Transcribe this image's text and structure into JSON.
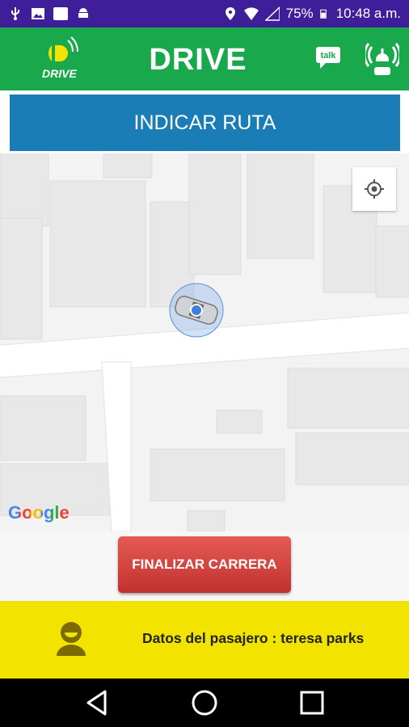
{
  "status_bar": {
    "battery": "75%",
    "time": "10:48 a.m.",
    "icons": [
      "usb-icon",
      "image-icon",
      "white-square-icon",
      "android-icon",
      "location-icon",
      "wifi-icon",
      "signal-icon",
      "battery-icon"
    ]
  },
  "app_bar": {
    "logo_text": "DRIVE",
    "title": "DRIVE",
    "talk_label": "talk",
    "colors": {
      "background": "#19a94c",
      "text": "#ffffff"
    }
  },
  "route_button": {
    "label": "INDICAR RUTA",
    "color": "#1b7db5"
  },
  "map": {
    "attribution": "Google"
  },
  "finish_button": {
    "label": "FINALIZAR CARRERA",
    "color": "#d64540"
  },
  "passenger": {
    "label": "Datos del pasajero : teresa parks",
    "color": "#f2e300"
  },
  "nav_bar": {
    "icons": [
      "back-icon",
      "home-icon",
      "recent-apps-icon"
    ]
  }
}
